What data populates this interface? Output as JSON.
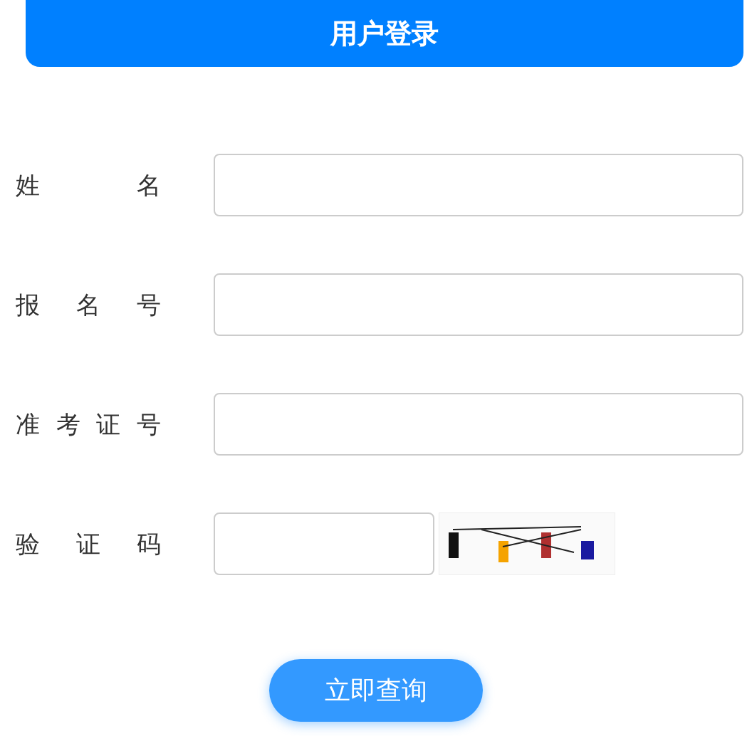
{
  "header": {
    "title": "用户登录"
  },
  "fields": [
    {
      "kind": "text",
      "label": "姓名"
    },
    {
      "kind": "text",
      "label": "报名号"
    },
    {
      "kind": "text",
      "label": "准考证号"
    },
    {
      "kind": "captcha",
      "label": "验证码"
    }
  ],
  "submit": {
    "label": "立即查询"
  }
}
